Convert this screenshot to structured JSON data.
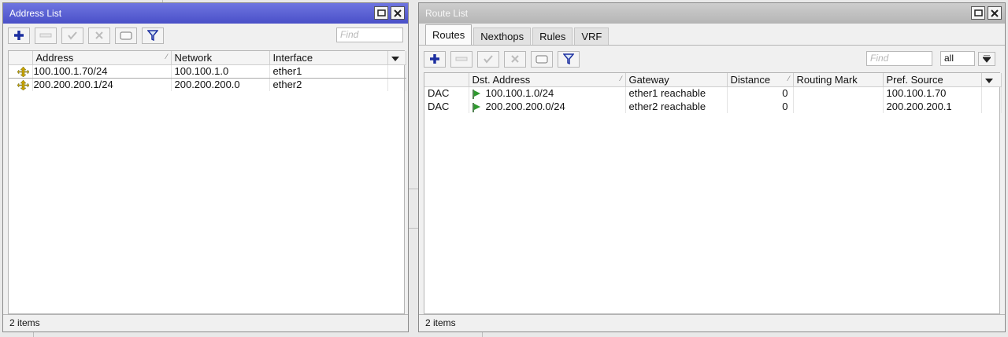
{
  "address_list": {
    "title": "Address List",
    "find_placeholder": "Find",
    "columns": [
      "Address",
      "Network",
      "Interface"
    ],
    "rows": [
      {
        "address": "100.100.1.70/24",
        "network": "100.100.1.0",
        "interface": "ether1"
      },
      {
        "address": "200.200.200.1/24",
        "network": "200.200.200.0",
        "interface": "ether2"
      }
    ],
    "status": "2 items"
  },
  "route_list": {
    "title": "Route List",
    "tabs": [
      "Routes",
      "Nexthops",
      "Rules",
      "VRF"
    ],
    "find_placeholder": "Find",
    "filter_value": "all",
    "columns": [
      "Dst. Address",
      "Gateway",
      "Distance",
      "Routing Mark",
      "Pref. Source"
    ],
    "rows": [
      {
        "flags": "DAC",
        "dst": "100.100.1.0/24",
        "gateway": "ether1 reachable",
        "distance": "0",
        "routing_mark": "",
        "pref_source": "100.100.1.70"
      },
      {
        "flags": "DAC",
        "dst": "200.200.200.0/24",
        "gateway": "ether2 reachable",
        "distance": "0",
        "routing_mark": "",
        "pref_source": "200.200.200.1"
      }
    ],
    "status": "2 items"
  },
  "colors": {
    "active_title": "#5258d0",
    "inactive_title": "#c2c2c2",
    "add_icon": "#1c2fa0",
    "route_flag": "#2e9a2e",
    "address_icon": "#c8a200"
  },
  "icons": [
    "add-icon",
    "remove-icon",
    "enable-icon",
    "disable-icon",
    "comment-icon",
    "filter-icon",
    "restore-icon",
    "close-icon",
    "route-flag-icon",
    "address-icon"
  ]
}
